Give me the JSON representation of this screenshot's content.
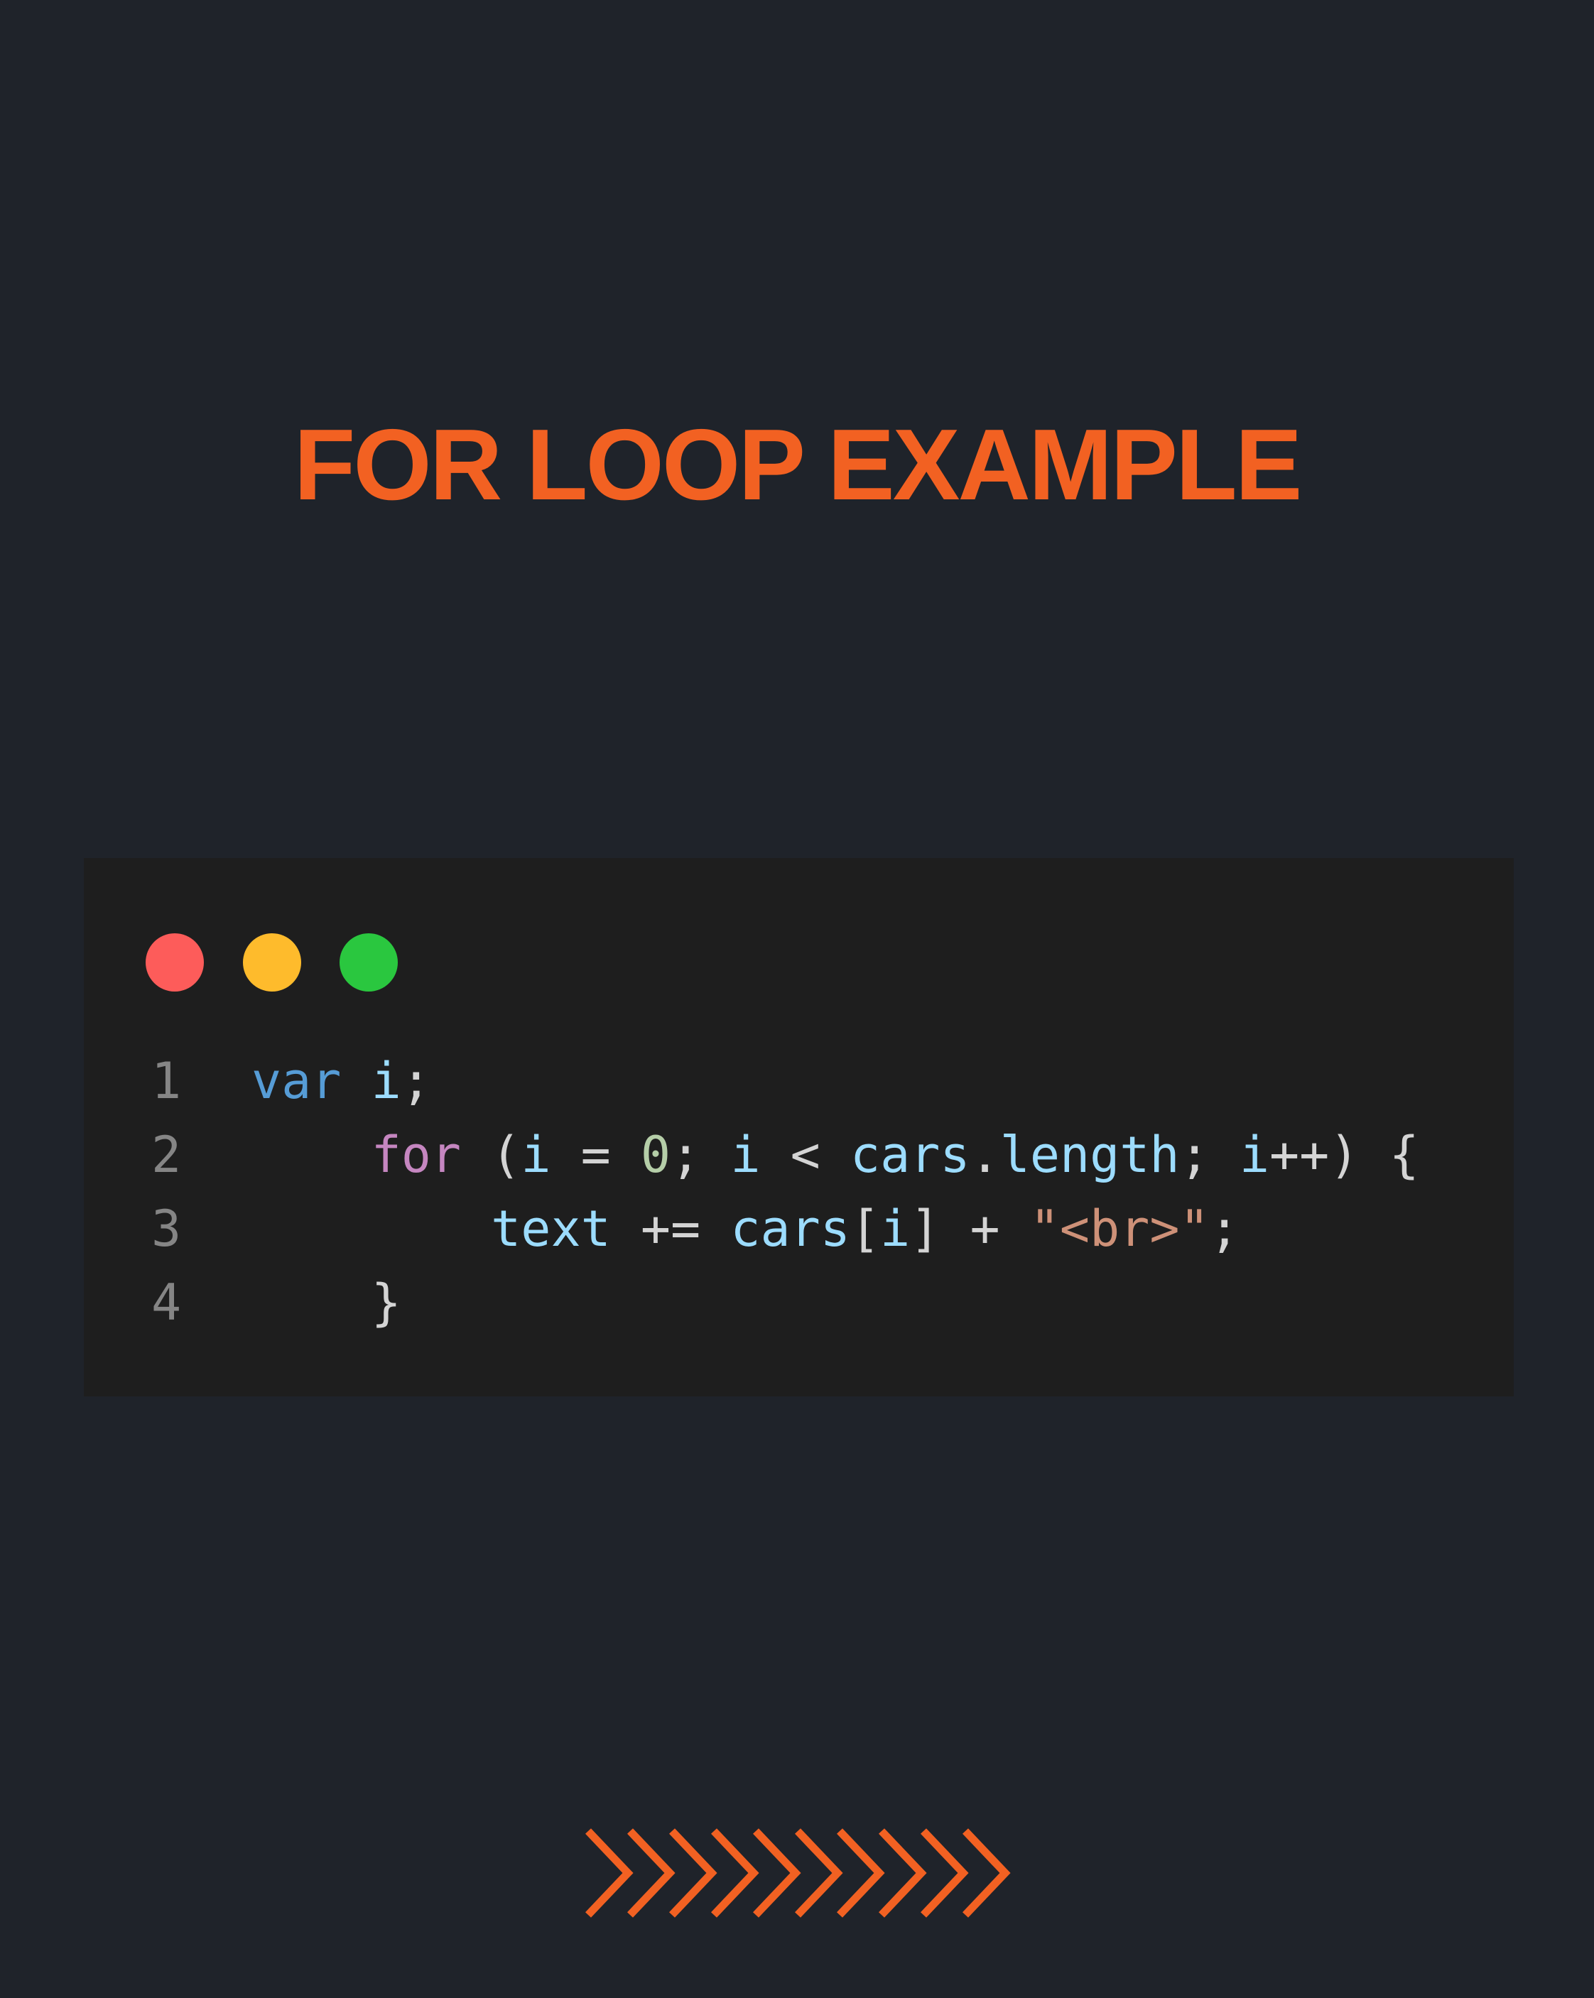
{
  "title": "FOR LOOP EXAMPLE",
  "colors": {
    "background": "#1f232a",
    "accent": "#f26122",
    "editor_background": "#1e1e1e",
    "window_close": "#fd5c5a",
    "window_minimize": "#febb2c",
    "window_maximize": "#2ac73f"
  },
  "code": {
    "language": "javascript",
    "lines": [
      {
        "number": "1",
        "tokens": [
          {
            "t": "var",
            "k": "kw"
          },
          {
            "t": " ",
            "k": "plain"
          },
          {
            "t": "i",
            "k": "var"
          },
          {
            "t": ";",
            "k": "plain"
          }
        ]
      },
      {
        "number": "2",
        "tokens": [
          {
            "t": "    ",
            "k": "plain"
          },
          {
            "t": "for",
            "k": "ctrl"
          },
          {
            "t": " (",
            "k": "plain"
          },
          {
            "t": "i",
            "k": "var"
          },
          {
            "t": " = ",
            "k": "plain"
          },
          {
            "t": "0",
            "k": "num"
          },
          {
            "t": "; ",
            "k": "plain"
          },
          {
            "t": "i",
            "k": "var"
          },
          {
            "t": " < ",
            "k": "plain"
          },
          {
            "t": "cars",
            "k": "var"
          },
          {
            "t": ".",
            "k": "plain"
          },
          {
            "t": "length",
            "k": "var"
          },
          {
            "t": "; ",
            "k": "plain"
          },
          {
            "t": "i",
            "k": "var"
          },
          {
            "t": "++) {",
            "k": "plain"
          }
        ]
      },
      {
        "number": "3",
        "tokens": [
          {
            "t": "        ",
            "k": "plain"
          },
          {
            "t": "text",
            "k": "var"
          },
          {
            "t": " += ",
            "k": "plain"
          },
          {
            "t": "cars",
            "k": "var"
          },
          {
            "t": "[",
            "k": "plain"
          },
          {
            "t": "i",
            "k": "var"
          },
          {
            "t": "] + ",
            "k": "plain"
          },
          {
            "t": "\"<br>\"",
            "k": "str"
          },
          {
            "t": ";",
            "k": "plain"
          }
        ]
      },
      {
        "number": "4",
        "tokens": [
          {
            "t": "    }",
            "k": "plain"
          }
        ]
      }
    ]
  },
  "decoration": {
    "icon": "chevron-right-icon",
    "count": 10
  }
}
